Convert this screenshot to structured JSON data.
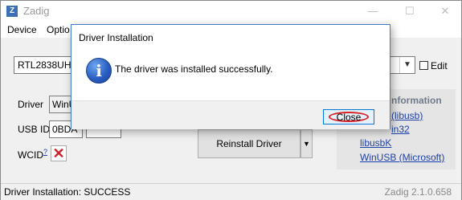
{
  "app": {
    "title": "Zadig",
    "icon_glyph": "Z",
    "controls": {
      "minimize": "—",
      "maximize": "☐",
      "close": "✕"
    }
  },
  "menu": {
    "items": [
      "Device",
      "Optio"
    ]
  },
  "device": {
    "selected": "RTL2838UHID",
    "edit_label": "Edit"
  },
  "fields": {
    "driver_label": "Driver",
    "driver_value": "WinU",
    "usbid_label": "USB ID",
    "usbid_value": "0BDA",
    "wcid_label": "WCID",
    "wcid_sup": "?",
    "wcid_mark": "✕"
  },
  "buttons": {
    "reinstall": "Reinstall Driver",
    "split_arrow": "▼"
  },
  "info_panel": {
    "heading": "nformation",
    "links": [
      "(libusb)",
      "in32",
      "libusbK",
      "WinUSB (Microsoft)"
    ]
  },
  "status": {
    "text": "Driver Installation: SUCCESS",
    "version": "Zadig 2.1.0.658"
  },
  "dialog": {
    "title": "Driver Installation",
    "icon": "information-icon",
    "icon_glyph": "i",
    "message": "The driver was installed successfully.",
    "close_label": "Close"
  }
}
